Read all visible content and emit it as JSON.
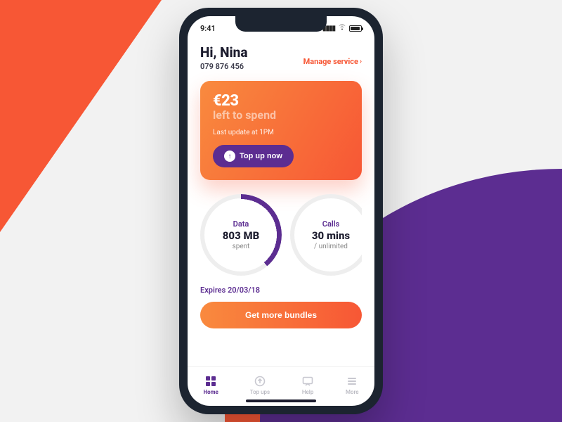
{
  "status": {
    "time": "9:41"
  },
  "header": {
    "greeting": "Hi, Nina",
    "phone": "079 876 456",
    "manage_label": "Manage service"
  },
  "balance": {
    "amount": "€23",
    "subtitle": "left to spend",
    "updated": "Last update at 1PM",
    "topup_label": "Top up now"
  },
  "usage": {
    "data": {
      "label": "Data",
      "value": "803 MB",
      "sub": "spent"
    },
    "calls": {
      "label": "Calls",
      "value": "30 mins",
      "sub": "/ unlimited"
    },
    "expires": "Expires 20/03/18"
  },
  "cta": {
    "bundles_label": "Get more bundles"
  },
  "tabs": {
    "home": "Home",
    "topups": "Top ups",
    "help": "Help",
    "more": "More"
  },
  "colors": {
    "accent": "#f75735",
    "brand": "#5c2d91"
  }
}
